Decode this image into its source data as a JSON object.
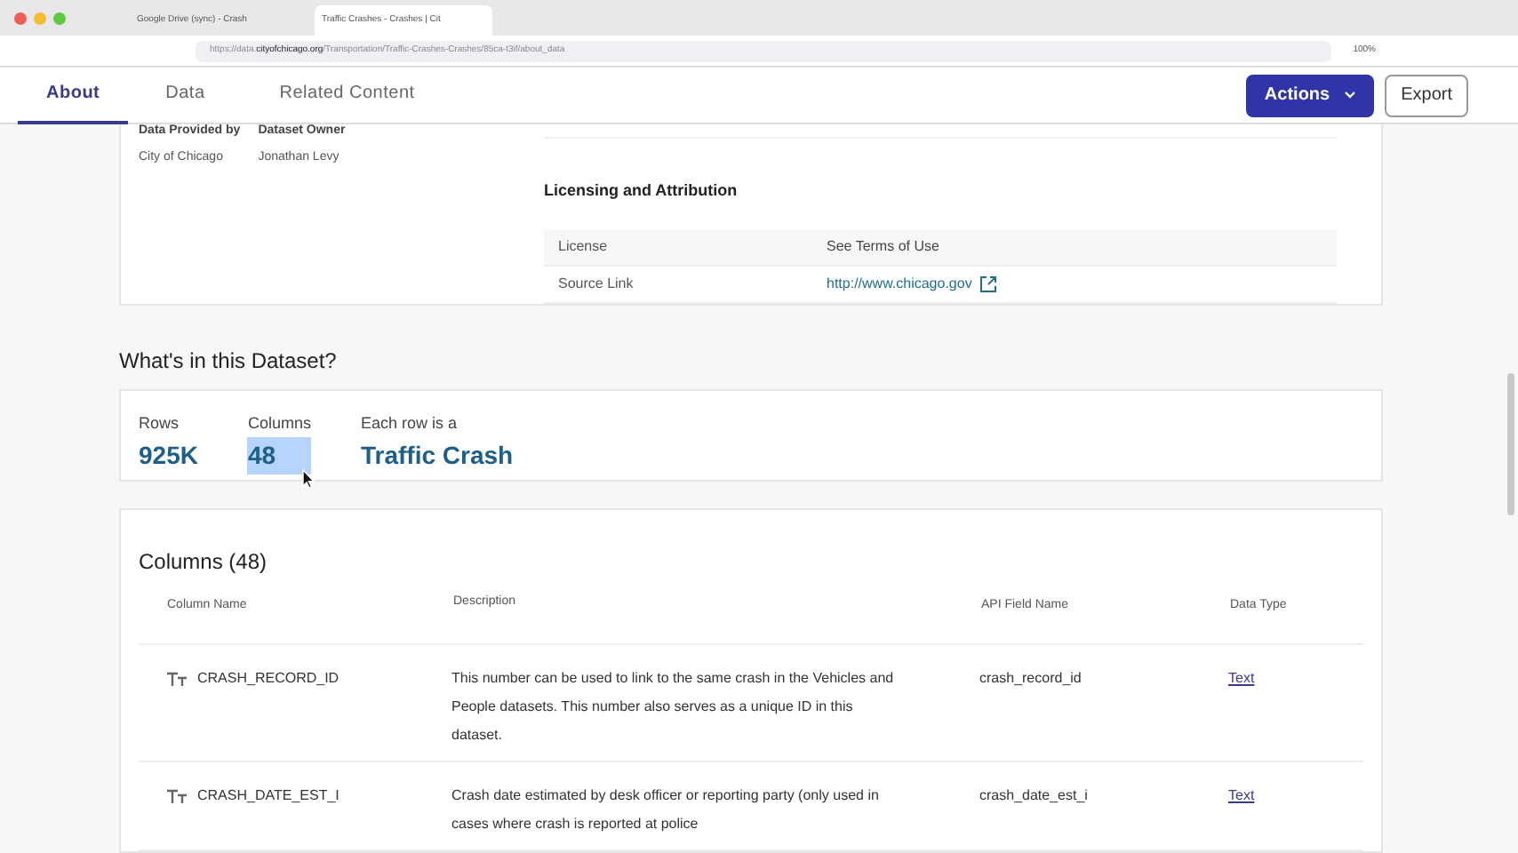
{
  "browser": {
    "tabs": [
      {
        "title": "Google Drive (sync) - Crash",
        "selected": false
      },
      {
        "title": "Traffic Crashes - Crashes | Cit",
        "selected": true
      }
    ],
    "url_prefix": "https://data.",
    "url_domain": "cityofchicago.org",
    "url_path": "/Transportation/Traffic-Crashes-Crashes/85ca-t3if/about_data",
    "zoom": "100%"
  },
  "nav": {
    "tabs": [
      {
        "label": "About",
        "selected": true
      },
      {
        "label": "Data",
        "selected": false
      },
      {
        "label": "Related Content",
        "selected": false
      }
    ],
    "actions": "Actions",
    "export": "Export"
  },
  "provided": {
    "fields": [
      {
        "label": "Data Provided by",
        "value": "City of Chicago"
      },
      {
        "label": "Dataset Owner",
        "value": "Jonathan Levy"
      }
    ]
  },
  "licensing": {
    "title": "Licensing and Attribution",
    "rows": [
      {
        "label": "License",
        "value": "See Terms of Use",
        "kind": "text"
      },
      {
        "label": "Source Link",
        "value": "http://www.chicago.gov",
        "kind": "link"
      }
    ]
  },
  "summary": {
    "title": "What's in this Dataset?",
    "stats": [
      {
        "label": "Rows",
        "value": "925K",
        "selected": false
      },
      {
        "label": "Columns",
        "value": "48",
        "selected": true
      },
      {
        "label": "Each row is a",
        "value": "Traffic Crash",
        "selected": false
      }
    ]
  },
  "columns": {
    "title": "Columns (48)",
    "headers": [
      "Column Name",
      "Description",
      "API Field Name",
      "Data Type"
    ],
    "rows": [
      {
        "name": "CRASH_RECORD_ID",
        "description": "This number can be used to link to the same crash in the Vehicles and People datasets. This number also serves as a unique ID in this dataset.",
        "api": "crash_record_id",
        "type": "Text"
      },
      {
        "name": "CRASH_DATE_EST_I",
        "description": "Crash date estimated by desk officer or reporting party (only used in cases where crash is reported at police",
        "api": "crash_date_est_i",
        "type": "Text"
      }
    ]
  }
}
